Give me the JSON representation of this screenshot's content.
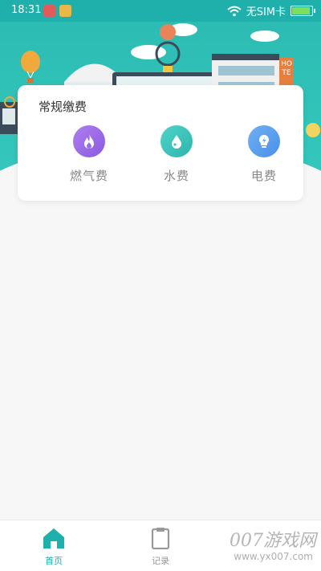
{
  "status_bar": {
    "time": "18:31",
    "carrier": "无SIM卡"
  },
  "banner": {
    "hotel_sign": "HOTE"
  },
  "card": {
    "title": "常规缴费",
    "items": [
      {
        "label": "燃气费",
        "icon": "flame-icon",
        "color": "#9b6ee8"
      },
      {
        "label": "水费",
        "icon": "water-drop-icon",
        "color": "#3ec7c0"
      },
      {
        "label": "电费",
        "icon": "lightbulb-icon",
        "color": "#5b9ff0"
      }
    ]
  },
  "bottom_nav": {
    "items": [
      {
        "label": "首页",
        "icon": "home-icon",
        "active": true
      },
      {
        "label": "记录",
        "icon": "clipboard-icon",
        "active": false
      }
    ],
    "active_color": "#1fb0ab",
    "inactive_color": "#999999"
  },
  "watermark": {
    "text": "007游戏网",
    "url": "www.yx007.com"
  }
}
